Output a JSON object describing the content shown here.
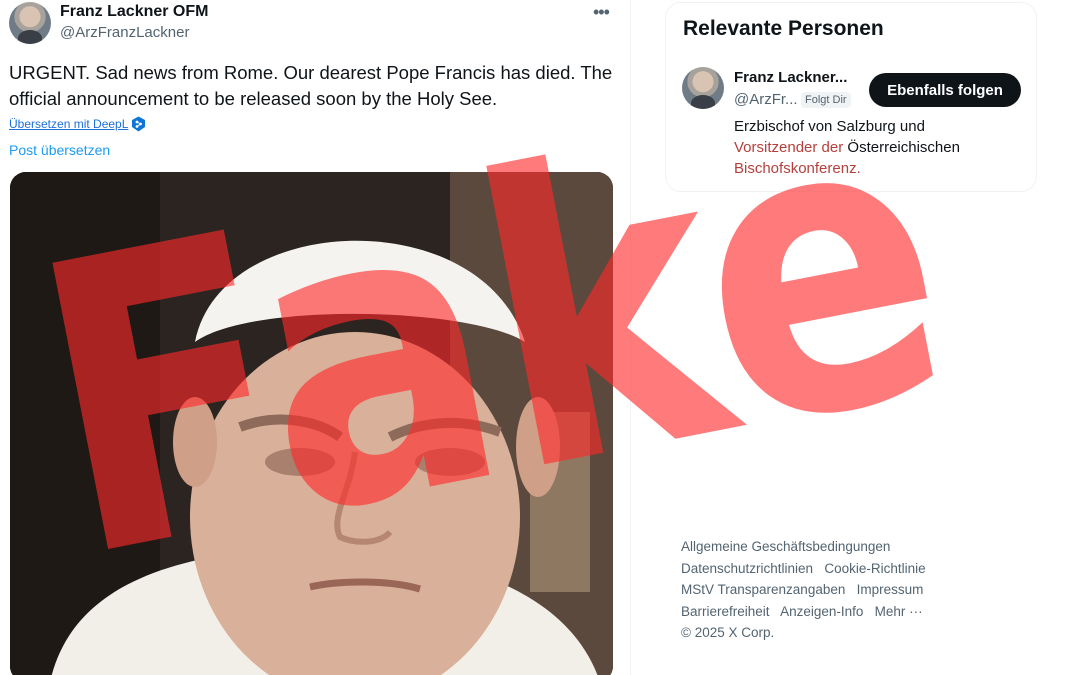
{
  "tweet": {
    "author_name": "Franz Lackner OFM",
    "author_handle": "@ArzFranzLackner",
    "more_icon": "…",
    "text": "URGENT. Sad news from Rome. Our dearest Pope Francis has died. The official announcement to be released soon by the Holy See.",
    "deepl_label": "Übersetzen mit DeepL",
    "translate_label": "Post übersetzen",
    "media_icon": "photo"
  },
  "sidebar": {
    "title": "Relevante Personen",
    "person": {
      "name": "Franz Lackner...",
      "handle": "@ArzFr...",
      "follows_badge": "Folgt Dir",
      "follow_label": "Ebenfalls folgen",
      "bio_plain": "Erzbischof von Salzburg und",
      "bio_highlight_1": "Vorsitzender der ",
      "bio_plain_2": "Österreichischen",
      "bio_highlight_2": "Bischofskonferenz."
    }
  },
  "footer": {
    "links": [
      "Allgemeine Geschäftsbedingungen",
      "Datenschutzrichtlinien",
      "Cookie-Richtlinie",
      "MStV Transparenzangaben",
      "Impressum",
      "Barrierefreiheit",
      "Anzeigen-Info",
      "Mehr ···"
    ],
    "copyright": "© 2025 X Corp."
  },
  "overlay": {
    "text": "Fake",
    "color": "#ff2a2a"
  },
  "colors": {
    "accent": "#1d9bf0",
    "text_primary": "#0f1419",
    "text_secondary": "#536471"
  }
}
